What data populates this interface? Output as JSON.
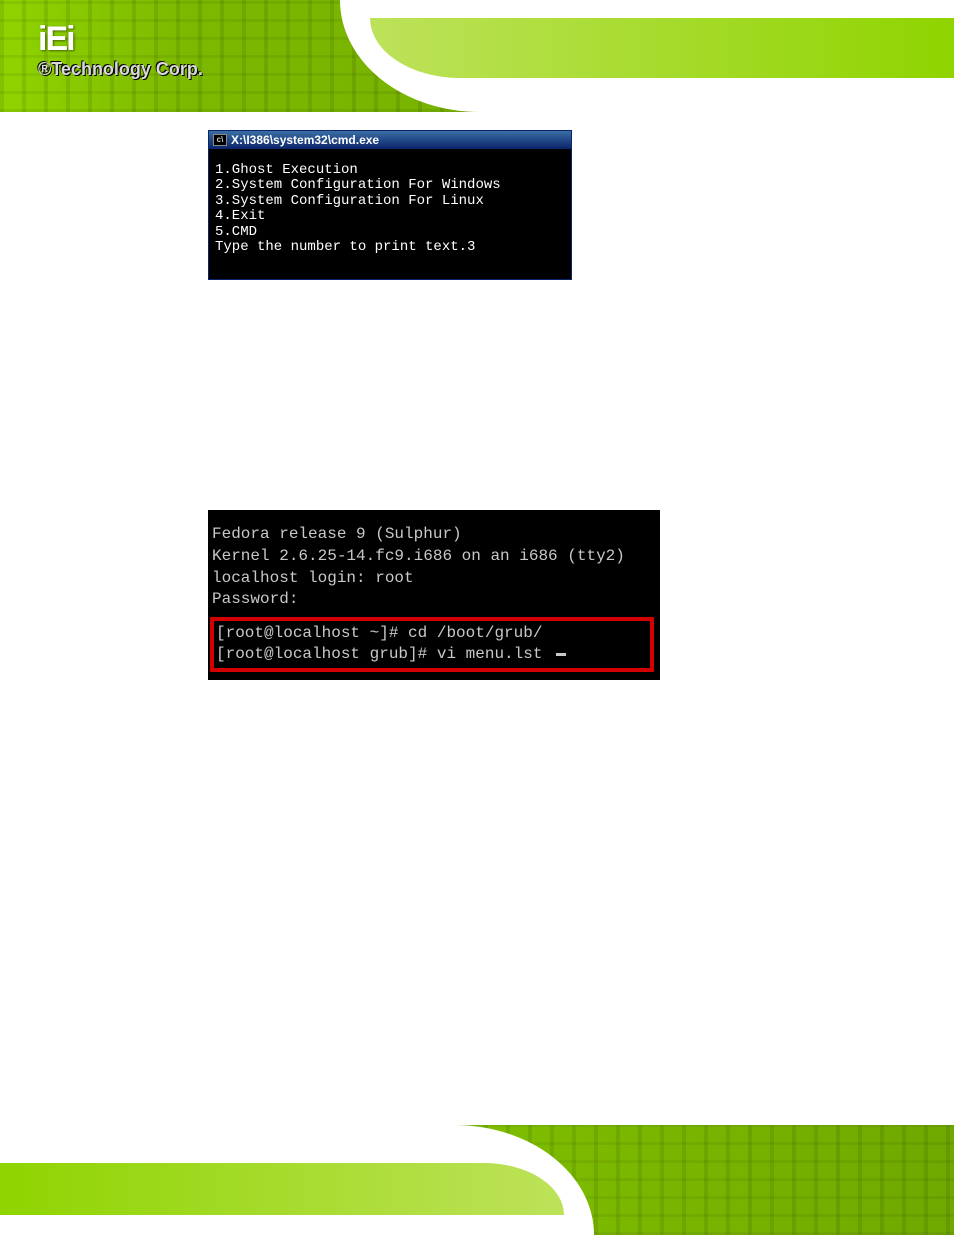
{
  "header": {
    "logo_text": "iEi",
    "tagline": "®Technology Corp."
  },
  "cmd": {
    "title": "X:\\I386\\system32\\cmd.exe",
    "lines": [
      "1.Ghost Execution",
      "2.System Configuration For Windows",
      "3.System Configuration For Linux",
      "4.Exit",
      "5.CMD",
      "Type the number to print text.3"
    ]
  },
  "linux": {
    "plain": [
      "Fedora release 9 (Sulphur)",
      "Kernel 2.6.25-14.fc9.i686 on an i686 (tty2)",
      "",
      "localhost login: root",
      "Password:"
    ],
    "highlighted": [
      "[root@localhost ~]# cd /boot/grub/",
      "[root@localhost grub]# vi menu.lst "
    ]
  }
}
